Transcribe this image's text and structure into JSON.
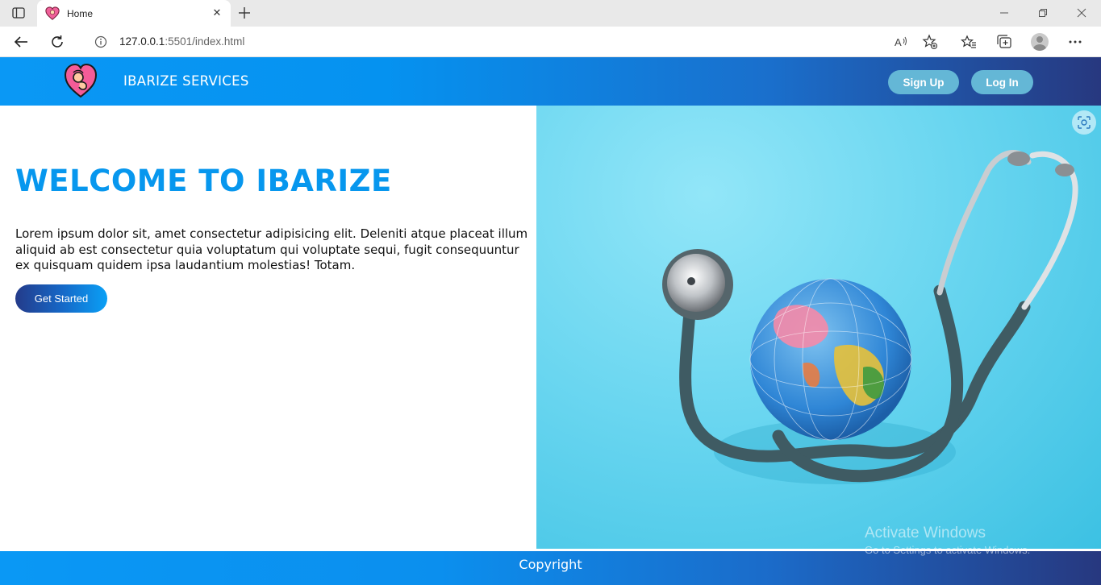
{
  "browser": {
    "tab": {
      "title": "Home",
      "favicon": "heart-logo-icon"
    },
    "address": {
      "host": "127.0.0.1",
      "rest": ":5501/index.html"
    },
    "colors": {
      "tabstrip": "#e9e9e9"
    }
  },
  "header": {
    "brand": "IBARIZE SERVICES",
    "signup_label": "Sign Up",
    "login_label": "Log In",
    "colors": {
      "gradient_start": "#0a98f5",
      "gradient_end": "#27387f",
      "button": "#64b7d6"
    }
  },
  "hero": {
    "title": "WELCOME TO IBARIZE",
    "text": "Lorem ipsum dolor sit, amet consectetur adipisicing elit. Deleniti atque placeat illum aliquid ab est consectetur quia voluptatum qui voluptate sequi, fugit consequuntur ex quisquam quidem ipsa laudantium molestias! Totam.",
    "cta_label": "Get Started",
    "title_color": "#0797ee"
  },
  "footer": {
    "text": "Copyright"
  },
  "watermark": {
    "line1": "Activate Windows",
    "line2": "Go to Settings to activate Windows."
  }
}
